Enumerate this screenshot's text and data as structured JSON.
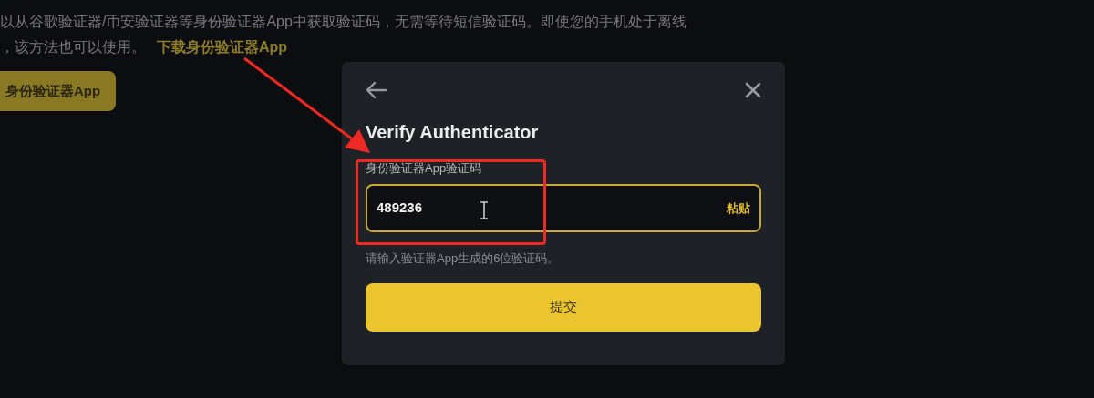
{
  "background_page": {
    "description_line_1": "以从谷歌验证器/币安验证器等身份验证器App中获取验证码，无需等待短信验证码。即使您的手机处于离线",
    "description_line_2": "，该方法也可以使用。",
    "download_link": "下载身份验证器App",
    "bind_button": "身份验证器App"
  },
  "dialog": {
    "title": "Verify Authenticator",
    "field": {
      "label": "身份验证器App验证码",
      "value": "489236",
      "paste_button": "粘贴",
      "hint": "请输入验证器App生成的6位验证码。"
    },
    "submit_button": "提交"
  }
}
